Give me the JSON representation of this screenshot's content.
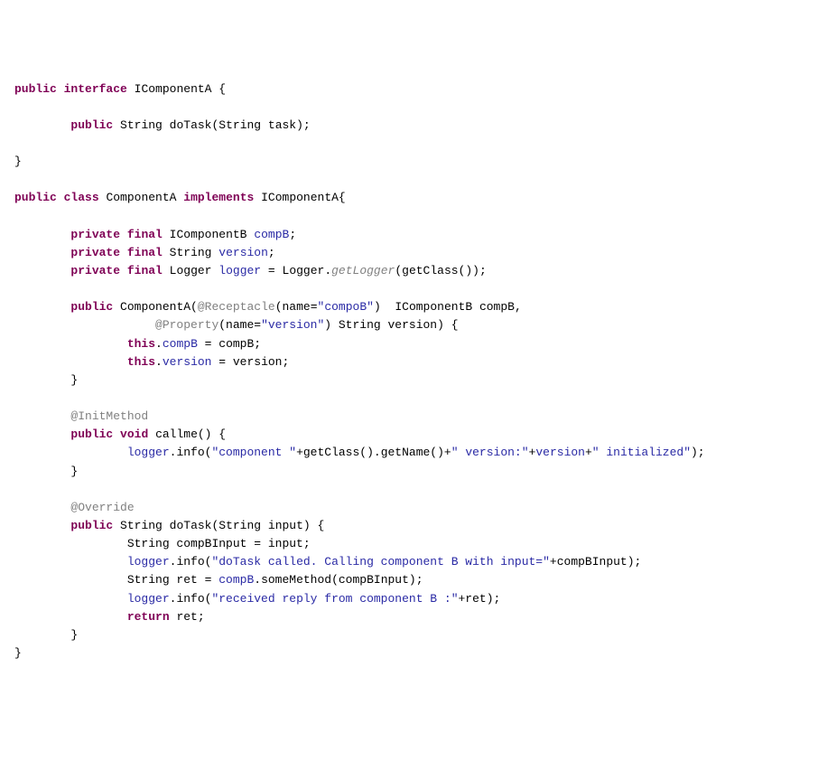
{
  "code": {
    "l1": {
      "kw_public": "public",
      "kw_interface": "interface",
      "type": "IComponentA",
      "brace": " {"
    },
    "l3": {
      "kw_public": "public",
      "ret": "String",
      "method": "doTask",
      "params": "(String task);"
    },
    "l5": {
      "brace": "}"
    },
    "l7": {
      "kw_public": "public",
      "kw_class": "class",
      "name": "ComponentA",
      "kw_impl": "implements",
      "iface": "IComponentA{"
    },
    "l9": {
      "kw_private": "private",
      "kw_final": "final",
      "type": "IComponentB",
      "field": "compB",
      "semi": ";"
    },
    "l10": {
      "kw_private": "private",
      "kw_final": "final",
      "type": "String",
      "field": "version",
      "semi": ";"
    },
    "l11": {
      "kw_private": "private",
      "kw_final": "final",
      "type": "Logger",
      "field": "logger",
      "eq": " = Logger.",
      "call": "getLogger",
      "tail": "(getClass());"
    },
    "l13": {
      "kw_public": "public",
      "ctor": "ComponentA(",
      "ann1": "@Receptacle",
      "ann1args": "(name=",
      "str1": "\"compoB\"",
      "after1": ")  IComponentB compB,"
    },
    "l14": {
      "ann2": "@Property",
      "ann2args": "(name=",
      "str2": "\"version\"",
      "after2": ") String version) {"
    },
    "l15": {
      "kw_this": "this",
      "dot": ".",
      "field": "compB",
      "rest": " = compB;"
    },
    "l16": {
      "kw_this": "this",
      "dot": ".",
      "field": "version",
      "rest": " = version;"
    },
    "l17": {
      "brace": "}"
    },
    "l19": {
      "ann": "@InitMethod"
    },
    "l20": {
      "kw_public": "public",
      "kw_void": "void",
      "method": "callme() {"
    },
    "l21": {
      "obj": "logger",
      "call": ".info(",
      "s1": "\"component \"",
      "mid": "+getClass().getName()+",
      "s2": "\" version:\"",
      "plus": "+",
      "fld": "version",
      "plus2": "+",
      "s3": "\" initialized\"",
      "end": ");"
    },
    "l22": {
      "brace": "}"
    },
    "l24": {
      "ann": "@Override"
    },
    "l25": {
      "kw_public": "public",
      "ret": "String",
      "sig": "doTask(String input) {"
    },
    "l26": {
      "txt": "String compBInput = input;"
    },
    "l27": {
      "obj": "logger",
      "call": ".info(",
      "s1": "\"doTask called. Calling component B with input=\"",
      "plus": "+compBInput);"
    },
    "l28": {
      "pre": "String ret = ",
      "obj": "compB",
      "rest": ".someMethod(compBInput);"
    },
    "l29": {
      "obj": "logger",
      "call": ".info(",
      "s1": "\"received reply from component B :\"",
      "plus": "+ret);"
    },
    "l30": {
      "kw_return": "return",
      "rest": " ret;"
    },
    "l31": {
      "brace": "}"
    },
    "l32": {
      "brace": "}"
    }
  }
}
